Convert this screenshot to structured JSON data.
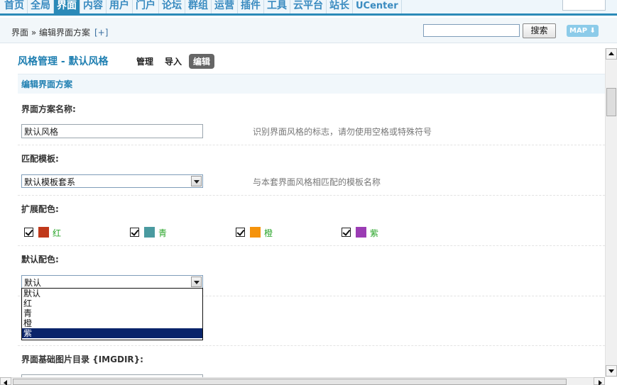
{
  "nav": {
    "tabs": [
      {
        "label": "首页"
      },
      {
        "label": "全局"
      },
      {
        "label": "界面",
        "active": true
      },
      {
        "label": "内容"
      },
      {
        "label": "用户"
      },
      {
        "label": "门户"
      },
      {
        "label": "论坛"
      },
      {
        "label": "群组"
      },
      {
        "label": "运营"
      },
      {
        "label": "插件"
      },
      {
        "label": "工具"
      },
      {
        "label": "云平台"
      },
      {
        "label": "站长"
      },
      {
        "label": "UCenter"
      }
    ]
  },
  "breadcrumb": {
    "text": "界面 » 编辑界面方案",
    "add": "[+]"
  },
  "search": {
    "value": "",
    "button": "搜索"
  },
  "map_button": "MAP ⬇",
  "page": {
    "title": "风格管理 - 默认风格",
    "tabs": [
      {
        "label": "管理"
      },
      {
        "label": "导入"
      },
      {
        "label": "编辑",
        "active": true
      }
    ]
  },
  "section_title": "编辑界面方案",
  "form": {
    "name_label": "界面方案名称:",
    "name_value": "默认风格",
    "name_hint": "识别界面风格的标志，请勿使用空格或特殊符号",
    "template_label": "匹配模板:",
    "template_value": "默认模板套系",
    "template_hint": "与本套界面风格相匹配的模板名称",
    "ext_colors_label": "扩展配色:",
    "ext_colors": [
      {
        "name": "红",
        "color": "#c0391b",
        "checked": true
      },
      {
        "name": "青",
        "color": "#4a9aa0",
        "checked": true
      },
      {
        "name": "橙",
        "color": "#f5930c",
        "checked": true
      },
      {
        "name": "紫",
        "color": "#9b3cb4",
        "checked": true
      }
    ],
    "default_color_label": "默认配色:",
    "default_color_value": "默认",
    "default_color_options": [
      "默认",
      "红",
      "青",
      "橙",
      "紫"
    ],
    "default_color_highlighted": "紫",
    "imgdir_label": "界面基础图片目录 {IMGDIR}:"
  }
}
